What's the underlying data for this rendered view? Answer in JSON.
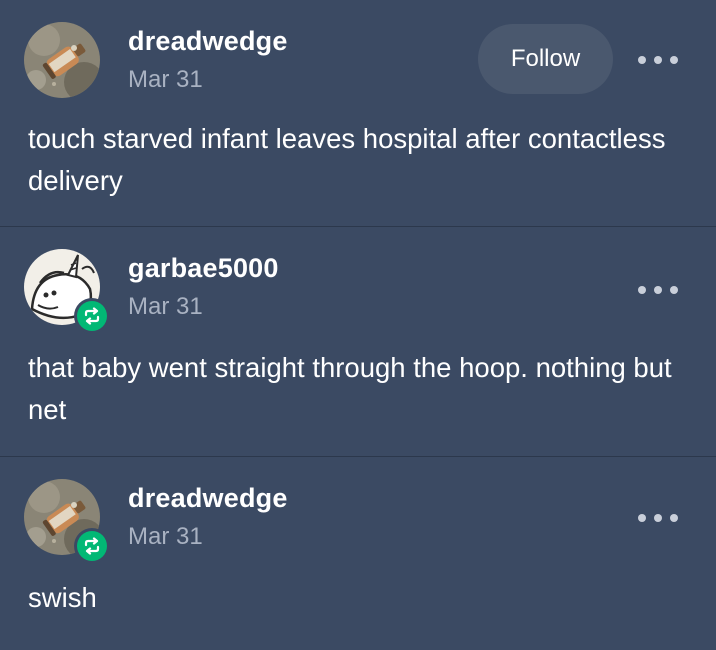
{
  "posts": [
    {
      "username": "dreadwedge",
      "date": "Mar 31",
      "follow_label": "Follow",
      "text": "touch starved infant leaves hospital after contactless delivery",
      "avatar_icon": "bottle-photo-avatar",
      "reblogged": false
    },
    {
      "username": "garbae5000",
      "date": "Mar 31",
      "text": "that baby went straight through the hoop. nothing but net",
      "avatar_icon": "cartoon-unicorn-avatar",
      "reblogged": true
    },
    {
      "username": "dreadwedge",
      "date": "Mar 31",
      "text": "swish",
      "avatar_icon": "bottle-photo-avatar",
      "reblogged": true
    }
  ],
  "colors": {
    "background": "#3b4a63",
    "divider": "#2c384c",
    "follow_button_bg": "#4a586e",
    "reblog_green": "#02b875",
    "date_text": "#a9b2c2"
  }
}
